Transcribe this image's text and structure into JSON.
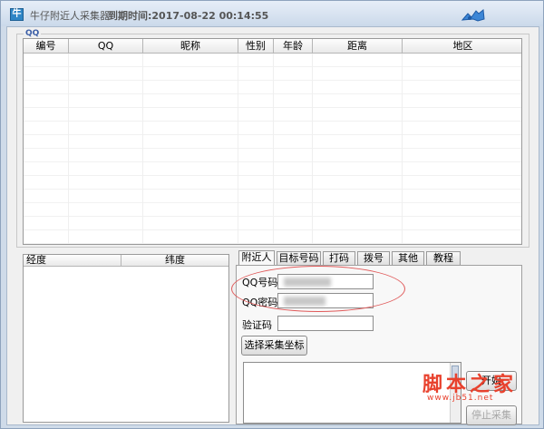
{
  "window": {
    "title": "牛仔附近人采集器",
    "expire": "到期时间:2017-08-22 00:14:55",
    "icon_text": "牛"
  },
  "qq_group_label": "QQ",
  "main_grid": {
    "columns": [
      "编号",
      "QQ",
      "昵称",
      "性别",
      "年龄",
      "距离",
      "地区"
    ]
  },
  "coords_grid": {
    "columns": [
      "经度",
      "纬度"
    ]
  },
  "tabs": [
    "附近人",
    "目标号码",
    "打码",
    "拨号",
    "其他",
    "教程"
  ],
  "form": {
    "qq_number_label": "QQ号码",
    "qq_password_label": "QQ密码",
    "captcha_label": "验证码",
    "captcha_value": "",
    "select_coords_button": "选择采集坐标"
  },
  "buttons": {
    "start": "开始",
    "stop": "停止采集"
  },
  "watermark": {
    "text": "脚本之家",
    "url": "www.jb51.net"
  },
  "colors": {
    "accent_blue": "#2f86c6",
    "highlight_red": "#e05a5a",
    "watermark_red": "#e8412d"
  }
}
